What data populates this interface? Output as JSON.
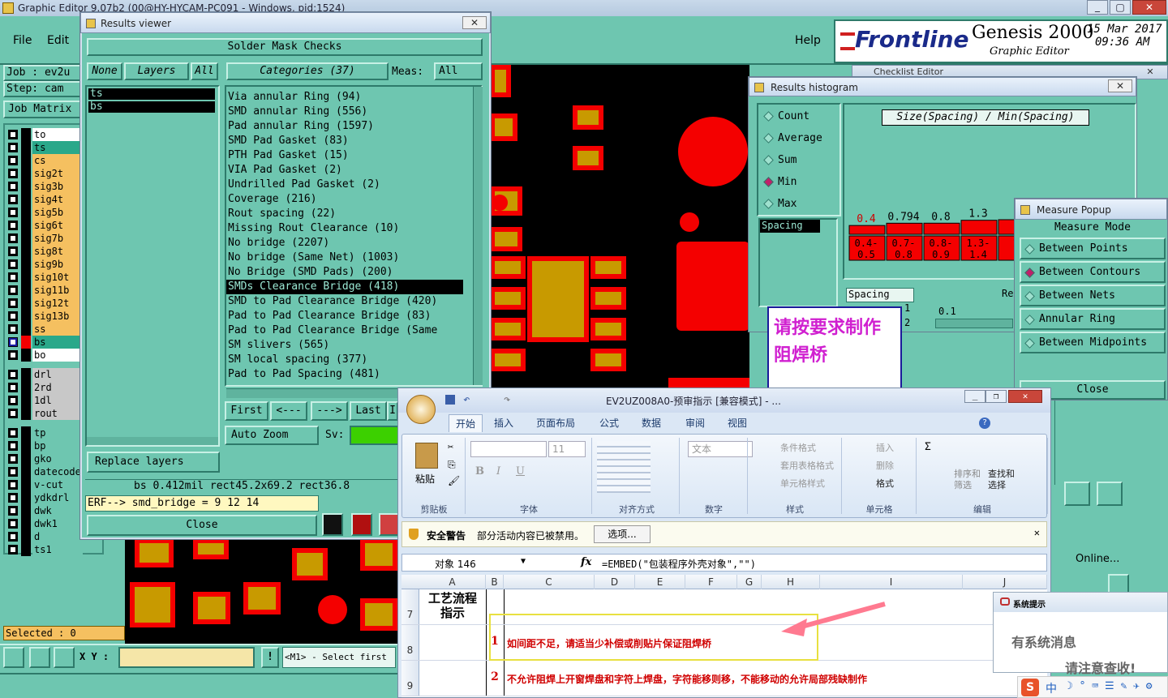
{
  "main_window": {
    "title": "Graphic Editor 9.07b2 (00@HY-HYCAM-PC091 - Windows, pid:1524)",
    "menu": {
      "file": "File",
      "edit": "Edit",
      "help": "Help"
    },
    "brand": {
      "logo": "Frontline",
      "product": "Genesis 2000",
      "subtitle": "Graphic Editor",
      "date": "15 Mar 2017",
      "time": "09:36 AM"
    },
    "job_label": "Job : ev2u",
    "step_label": "Step: cam",
    "job_matrix": "Job Matrix",
    "selected": "Selected : 0",
    "xy_label": "X Y :",
    "status_hint": "<M1> - Select first",
    "online": "Online..."
  },
  "layers_panel": [
    {
      "name": "to",
      "color": "#ffffff",
      "active": false
    },
    {
      "name": "ts",
      "color": "#2aa88a",
      "active": false
    },
    {
      "name": "cs",
      "color": "#f5c060",
      "active": false
    },
    {
      "name": "sig2t",
      "color": "#f5c060",
      "active": false
    },
    {
      "name": "sig3b",
      "color": "#f5c060",
      "active": false
    },
    {
      "name": "sig4t",
      "color": "#f5c060",
      "active": false
    },
    {
      "name": "sig5b",
      "color": "#f5c060",
      "active": false
    },
    {
      "name": "sig6t",
      "color": "#f5c060",
      "active": false
    },
    {
      "name": "sig7b",
      "color": "#f5c060",
      "active": false
    },
    {
      "name": "sig8t",
      "color": "#f5c060",
      "active": false
    },
    {
      "name": "sig9b",
      "color": "#f5c060",
      "active": false
    },
    {
      "name": "sig10t",
      "color": "#f5c060",
      "active": false
    },
    {
      "name": "sig11b",
      "color": "#f5c060",
      "active": false
    },
    {
      "name": "sig12t",
      "color": "#f5c060",
      "active": false
    },
    {
      "name": "sig13b",
      "color": "#f5c060",
      "active": false
    },
    {
      "name": "ss",
      "color": "#f5c060",
      "active": false
    },
    {
      "name": "bs",
      "color": "#2aa88a",
      "active": true
    },
    {
      "name": "bo",
      "color": "#ffffff",
      "active": false
    },
    {
      "name": "drl",
      "color": "#c8c8c8",
      "active": false
    },
    {
      "name": "2rd",
      "color": "#c8c8c8",
      "active": false
    },
    {
      "name": "1dl",
      "color": "#c8c8c8",
      "active": false
    },
    {
      "name": "rout",
      "color": "#c8c8c8",
      "active": false
    },
    {
      "name": "tp",
      "color": "#6ec6b0",
      "active": false
    },
    {
      "name": "bp",
      "color": "#6ec6b0",
      "active": false
    },
    {
      "name": "gko",
      "color": "#6ec6b0",
      "active": false
    },
    {
      "name": "datecode",
      "color": "#6ec6b0",
      "active": false
    },
    {
      "name": "v-cut",
      "color": "#6ec6b0",
      "active": false
    },
    {
      "name": "ydkdrl",
      "color": "#6ec6b0",
      "active": false
    },
    {
      "name": "dwk",
      "color": "#6ec6b0",
      "active": false
    },
    {
      "name": "dwk1",
      "color": "#6ec6b0",
      "active": false
    },
    {
      "name": "d",
      "color": "#6ec6b0",
      "active": false
    },
    {
      "name": "ts1",
      "color": "#6ec6b0",
      "active": false
    }
  ],
  "results_viewer": {
    "title": "Results viewer",
    "header": "Solder Mask Checks",
    "none_btn": "None",
    "layers_label": "Layers",
    "all_btn": "All",
    "categories_label": "Categories (37)",
    "meas_label": "Meas:",
    "meas_value": "All",
    "layers": [
      "ts",
      "bs"
    ],
    "categories": [
      "Via annular Ring (94)",
      "SMD annular Ring (556)",
      "Pad annular Ring (1597)",
      "SMD Pad Gasket (83)",
      "PTH Pad Gasket (15)",
      "VIA Pad Gasket (2)",
      "Undrilled Pad Gasket (2)",
      "Coverage (216)",
      "Rout spacing (22)",
      "Missing Rout Clearance (10)",
      "No bridge (2207)",
      "No bridge (Same Net) (1003)",
      "No Bridge (SMD Pads) (200)",
      "SMDs Clearance Bridge (418)",
      "SMD to Pad Clearance Bridge (420)",
      "Pad to Pad Clearance Bridge (83)",
      "Pad to Pad Clearance Bridge (Same",
      "SM slivers (565)",
      "SM local spacing (377)",
      "Pad to Pad Spacing (481)"
    ],
    "selected_index": 13,
    "nav": {
      "first": "First",
      "prev": "<---",
      "next": "--->",
      "last": "Last",
      "i": "I"
    },
    "auto_zoom": "Auto Zoom",
    "sv_label": "Sv:",
    "replace_layers": "Replace layers",
    "info_line": "bs 0.412mil  rect45.2x69.2  rect36.8",
    "erf_line": "ERF--> smd_bridge = 9 12 14",
    "close": "Close"
  },
  "results_histogram": {
    "title": "Results histogram",
    "checklist_title": "Checklist Editor",
    "options": [
      {
        "label": "Count",
        "on": false
      },
      {
        "label": "Average",
        "on": false
      },
      {
        "label": "Sum",
        "on": false
      },
      {
        "label": "Min",
        "on": true
      },
      {
        "label": "Max",
        "on": false
      }
    ],
    "chart_title": "Size(Spacing) / Min(Spacing)",
    "spacing_label": "Spacing",
    "spacing_label2": "Spacing",
    "res_label": "Res",
    "scale_value": "0.1",
    "side_values": [
      "1",
      "2"
    ]
  },
  "chart_data": {
    "type": "bar",
    "title": "Size(Spacing) / Min(Spacing)",
    "categories": [
      "0.4-\n0.5",
      "0.7-\n0.8",
      "0.8-\n0.9",
      "1.3-\n1.4",
      "1"
    ],
    "labels": [
      "0.4",
      "0.794",
      "0.8",
      "1.3",
      ""
    ],
    "values": [
      0.4,
      0.794,
      0.8,
      1.3,
      1.4
    ]
  },
  "measure_popup": {
    "title": "Measure Popup",
    "mode_label": "Measure Mode",
    "modes": [
      {
        "label": "Between Points",
        "on": false
      },
      {
        "label": "Between Contours",
        "on": true
      },
      {
        "label": "Between Nets",
        "on": false
      },
      {
        "label": "Annular Ring",
        "on": false
      },
      {
        "label": "Between Midpoints",
        "on": false
      }
    ],
    "close": "Close"
  },
  "note_box": {
    "text1": "请按要求制作",
    "text2": "阻焊桥"
  },
  "excel": {
    "title": "EV2UZ008A0-预审指示 [兼容模式] - ...",
    "tabs": [
      "开始",
      "插入",
      "页面布局",
      "公式",
      "数据",
      "审阅",
      "视图"
    ],
    "groups": [
      "剪贴板",
      "字体",
      "对齐方式",
      "数字",
      "样式",
      "单元格",
      "编辑"
    ],
    "paste": "粘贴",
    "font_size": "11",
    "number_format": "文本",
    "styles": [
      "条件格式",
      "套用表格格式",
      "单元格样式"
    ],
    "cells_btns": [
      "插入",
      "删除",
      "格式"
    ],
    "sort": "排序和\n筛选",
    "find": "查找和\n选择",
    "security_title": "安全警告",
    "security_msg": "部分活动内容已被禁用。",
    "options_btn": "选项...",
    "name_box": "对象 146",
    "fx": "fx",
    "formula": "=EMBED(\"包装程序外壳对象\",\"\")",
    "columns": [
      "A",
      "B",
      "C",
      "D",
      "E",
      "F",
      "G",
      "H",
      "I",
      "J"
    ],
    "rows": [
      {
        "num": "7",
        "a": "工艺流程\n指示",
        "b": "",
        "c": ""
      },
      {
        "num": "8",
        "a": "",
        "b": "1",
        "c": "如间距不足，请适当少补偿或削贴片保证阻焊桥"
      },
      {
        "num": "9",
        "a": "",
        "b": "2",
        "c": "不允许阻焊上开窗焊盘和字符上焊盘，字符能移则移，不能移动的允许局部残缺制作"
      }
    ]
  },
  "sys_popup": {
    "title": "系统提示",
    "line1": "有系统消息",
    "line2": "请注意查收!"
  },
  "tray": {
    "ime": "中"
  }
}
